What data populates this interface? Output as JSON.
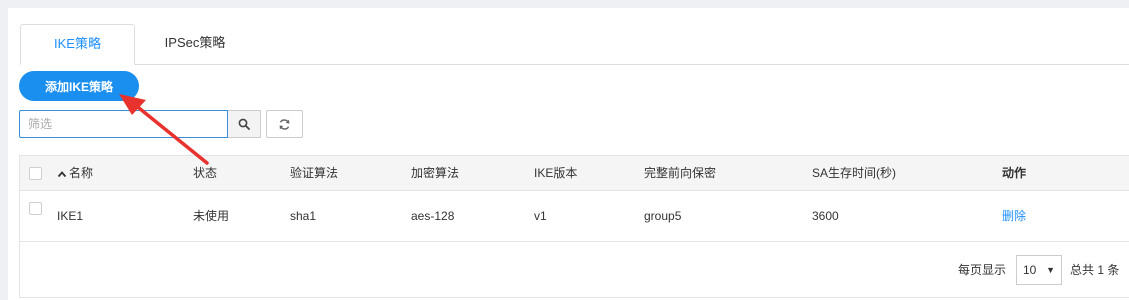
{
  "tabs": [
    {
      "label": "IKE策略",
      "active": true
    },
    {
      "label": "IPSec策略",
      "active": false
    }
  ],
  "toolbar": {
    "add_label": "添加IKE策略",
    "filter_placeholder": "筛选"
  },
  "table": {
    "headers": {
      "name": "名称",
      "status": "状态",
      "auth": "验证算法",
      "encrypt": "加密算法",
      "ike_version": "IKE版本",
      "pfs": "完整前向保密",
      "sa_lifetime": "SA生存时间(秒)",
      "action": "动作"
    },
    "rows": [
      {
        "name": "IKE1",
        "status": "未使用",
        "auth": "sha1",
        "encrypt": "aes-128",
        "ike_version": "v1",
        "pfs": "group5",
        "sa_lifetime": "3600",
        "action": "删除"
      }
    ]
  },
  "pagination": {
    "per_page_label": "每页显示",
    "per_page_value": "10",
    "total_label": "总共 1 条"
  },
  "colors": {
    "accent": "#1e90ff",
    "annotation_arrow": "#e8322e"
  }
}
